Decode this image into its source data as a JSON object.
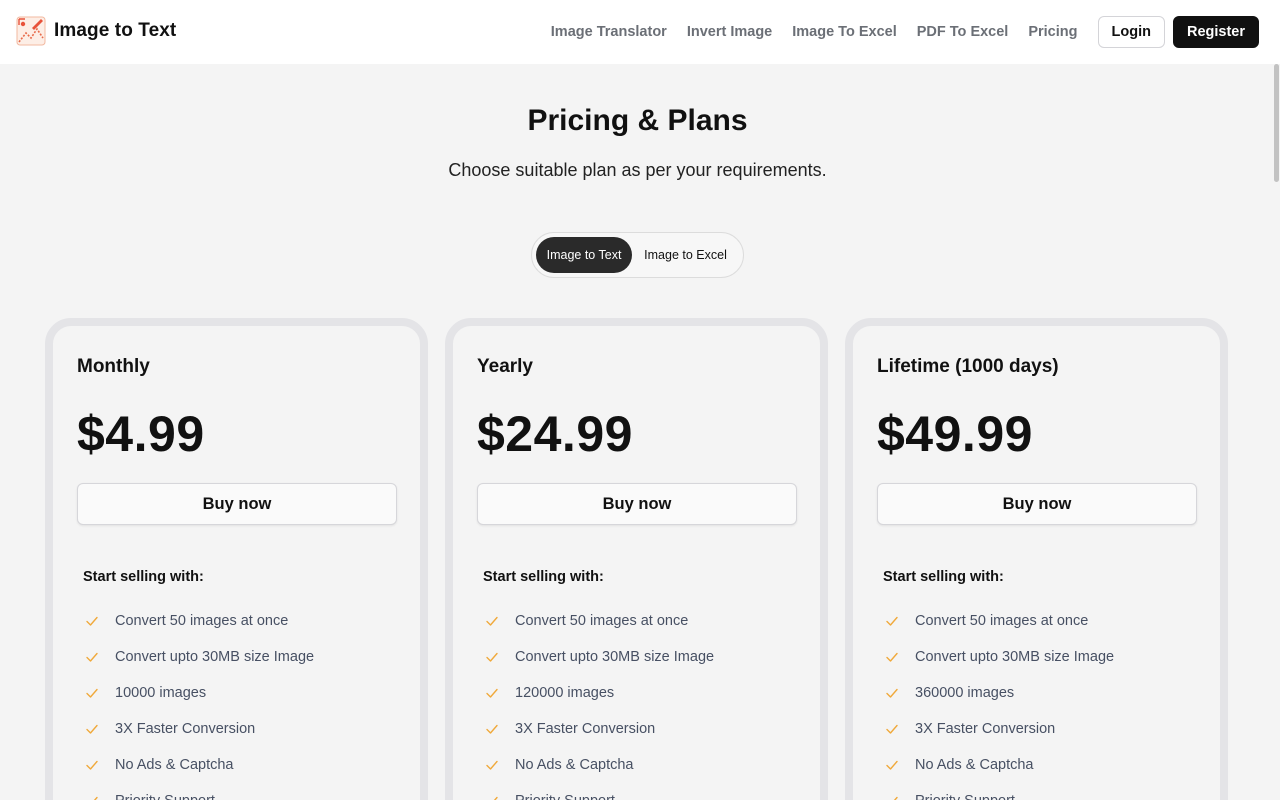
{
  "brand": {
    "name": "Image to Text"
  },
  "nav": {
    "links": [
      "Image Translator",
      "Invert Image",
      "Image To Excel",
      "PDF To Excel",
      "Pricing"
    ],
    "login": "Login",
    "register": "Register"
  },
  "hero": {
    "title": "Pricing & Plans",
    "subtitle": "Choose suitable plan as per your requirements."
  },
  "toggle": {
    "options": [
      "Image to Text",
      "Image to Excel"
    ],
    "selected": "Image to Text"
  },
  "plans": [
    {
      "name": "Monthly",
      "price": "$4.99",
      "cta": "Buy now",
      "features_heading": "Start selling with:",
      "features": [
        "Convert 50 images at once",
        "Convert upto 30MB size Image",
        "10000 images",
        "3X Faster Conversion",
        "No Ads & Captcha",
        "Priority Support"
      ]
    },
    {
      "name": "Yearly",
      "price": "$24.99",
      "cta": "Buy now",
      "features_heading": "Start selling with:",
      "features": [
        "Convert 50 images at once",
        "Convert upto 30MB size Image",
        "120000 images",
        "3X Faster Conversion",
        "No Ads & Captcha",
        "Priority Support"
      ]
    },
    {
      "name": "Lifetime (1000 days)",
      "price": "$49.99",
      "cta": "Buy now",
      "features_heading": "Start selling with:",
      "features": [
        "Convert 50 images at once",
        "Convert upto 30MB size Image",
        "360000 images",
        "3X Faster Conversion",
        "No Ads & Captcha",
        "Priority Support"
      ]
    }
  ],
  "colors": {
    "accent_dark": "#111111",
    "check": "#f0a93b",
    "background": "#f4f4f4",
    "card_border": "#e4e4e7"
  }
}
